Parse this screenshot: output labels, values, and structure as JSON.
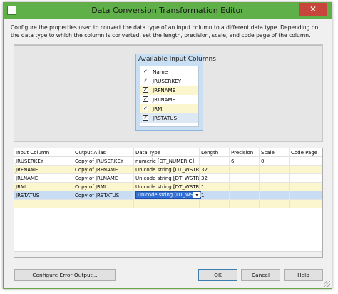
{
  "window": {
    "title": "Data Conversion Transformation Editor",
    "close_glyph": "✕"
  },
  "description": "Configure the properties used to convert the data type of an input column to a different data type. Depending on the data type to which the column is converted, set the length, precision, scale, and code page of the column.",
  "available_columns": {
    "title": "Available Input Columns",
    "items": [
      {
        "label": "Name",
        "checked": true
      },
      {
        "label": "JRUSERKEY",
        "checked": true
      },
      {
        "label": "JRFNAME",
        "checked": true
      },
      {
        "label": "JRLNAME",
        "checked": true
      },
      {
        "label": "JRMI",
        "checked": true
      },
      {
        "label": "JRSTATUS",
        "checked": true
      }
    ]
  },
  "grid": {
    "headers": [
      "Input Column",
      "Output Alias",
      "Data Type",
      "Length",
      "Precision",
      "Scale",
      "Code Page"
    ],
    "rows": [
      [
        "JRUSERKEY",
        "Copy of JRUSERKEY",
        "numeric [DT_NUMERIC]",
        "",
        "6",
        "0",
        ""
      ],
      [
        "JRFNAME",
        "Copy of JRFNAME",
        "Unicode string [DT_WSTR]",
        "32",
        "",
        "",
        ""
      ],
      [
        "JRLNAME",
        "Copy of JRLNAME",
        "Unicode string [DT_WSTR]",
        "32",
        "",
        "",
        ""
      ],
      [
        "JRMI",
        "Copy of JRMI",
        "Unicode string [DT_WSTR]",
        "1",
        "",
        "",
        ""
      ],
      [
        "JRSTATUS",
        "Copy of JRSTATUS",
        "Unicode string [DT_WSTR]",
        "1",
        "",
        "",
        ""
      ]
    ],
    "selected_row": 4,
    "dropdown_arrow": "▾"
  },
  "buttons": {
    "configure_error": "Configure Error Output...",
    "ok": "OK",
    "cancel": "Cancel",
    "help": "Help"
  },
  "colors": {
    "titlebar": "#5fb048",
    "close": "#c7453a",
    "selection": "#2f6fd6",
    "alt_row": "#fcf6cf"
  }
}
